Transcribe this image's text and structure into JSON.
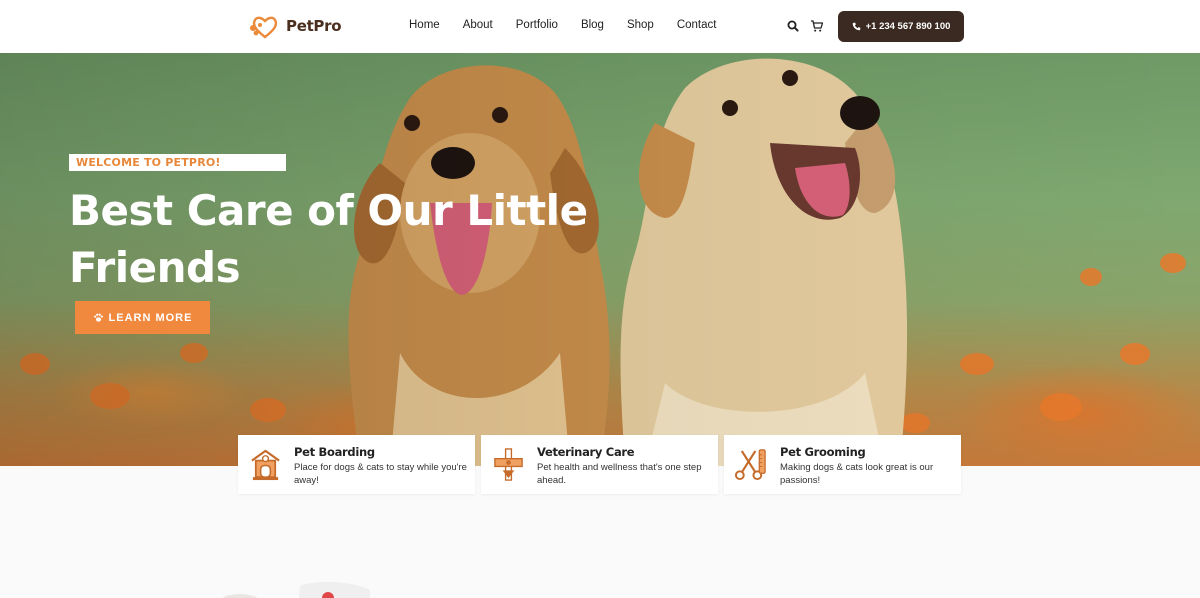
{
  "brand": {
    "name": "PetPro"
  },
  "nav": {
    "items": [
      {
        "label": "Home"
      },
      {
        "label": "About"
      },
      {
        "label": "Portfolio"
      },
      {
        "label": "Blog"
      },
      {
        "label": "Shop"
      },
      {
        "label": "Contact"
      }
    ]
  },
  "header": {
    "icons": [
      "search-icon",
      "cart-icon"
    ],
    "phone_label": "+1 234 567 890 100"
  },
  "hero": {
    "welcome": "WELCOME TO PETPRO!",
    "title": "Best Care of Our Little Friends",
    "cta_label": "LEARN MORE",
    "cta_icon": "paw-icon"
  },
  "services": [
    {
      "title": "Pet Boarding",
      "desc": "Place for dogs & cats to stay while you're away!",
      "icon": "pet-house-icon"
    },
    {
      "title": "Veterinary Care",
      "desc": "Pet health and wellness that's one step ahead.",
      "icon": "vet-cross-icon"
    },
    {
      "title": "Pet Grooming",
      "desc": "Making dogs & cats look great is our passions!",
      "icon": "scissors-comb-icon"
    }
  ],
  "colors": {
    "accent": "#f0883e",
    "dark": "#3a2a22",
    "welcome_text": "#e8873a"
  }
}
